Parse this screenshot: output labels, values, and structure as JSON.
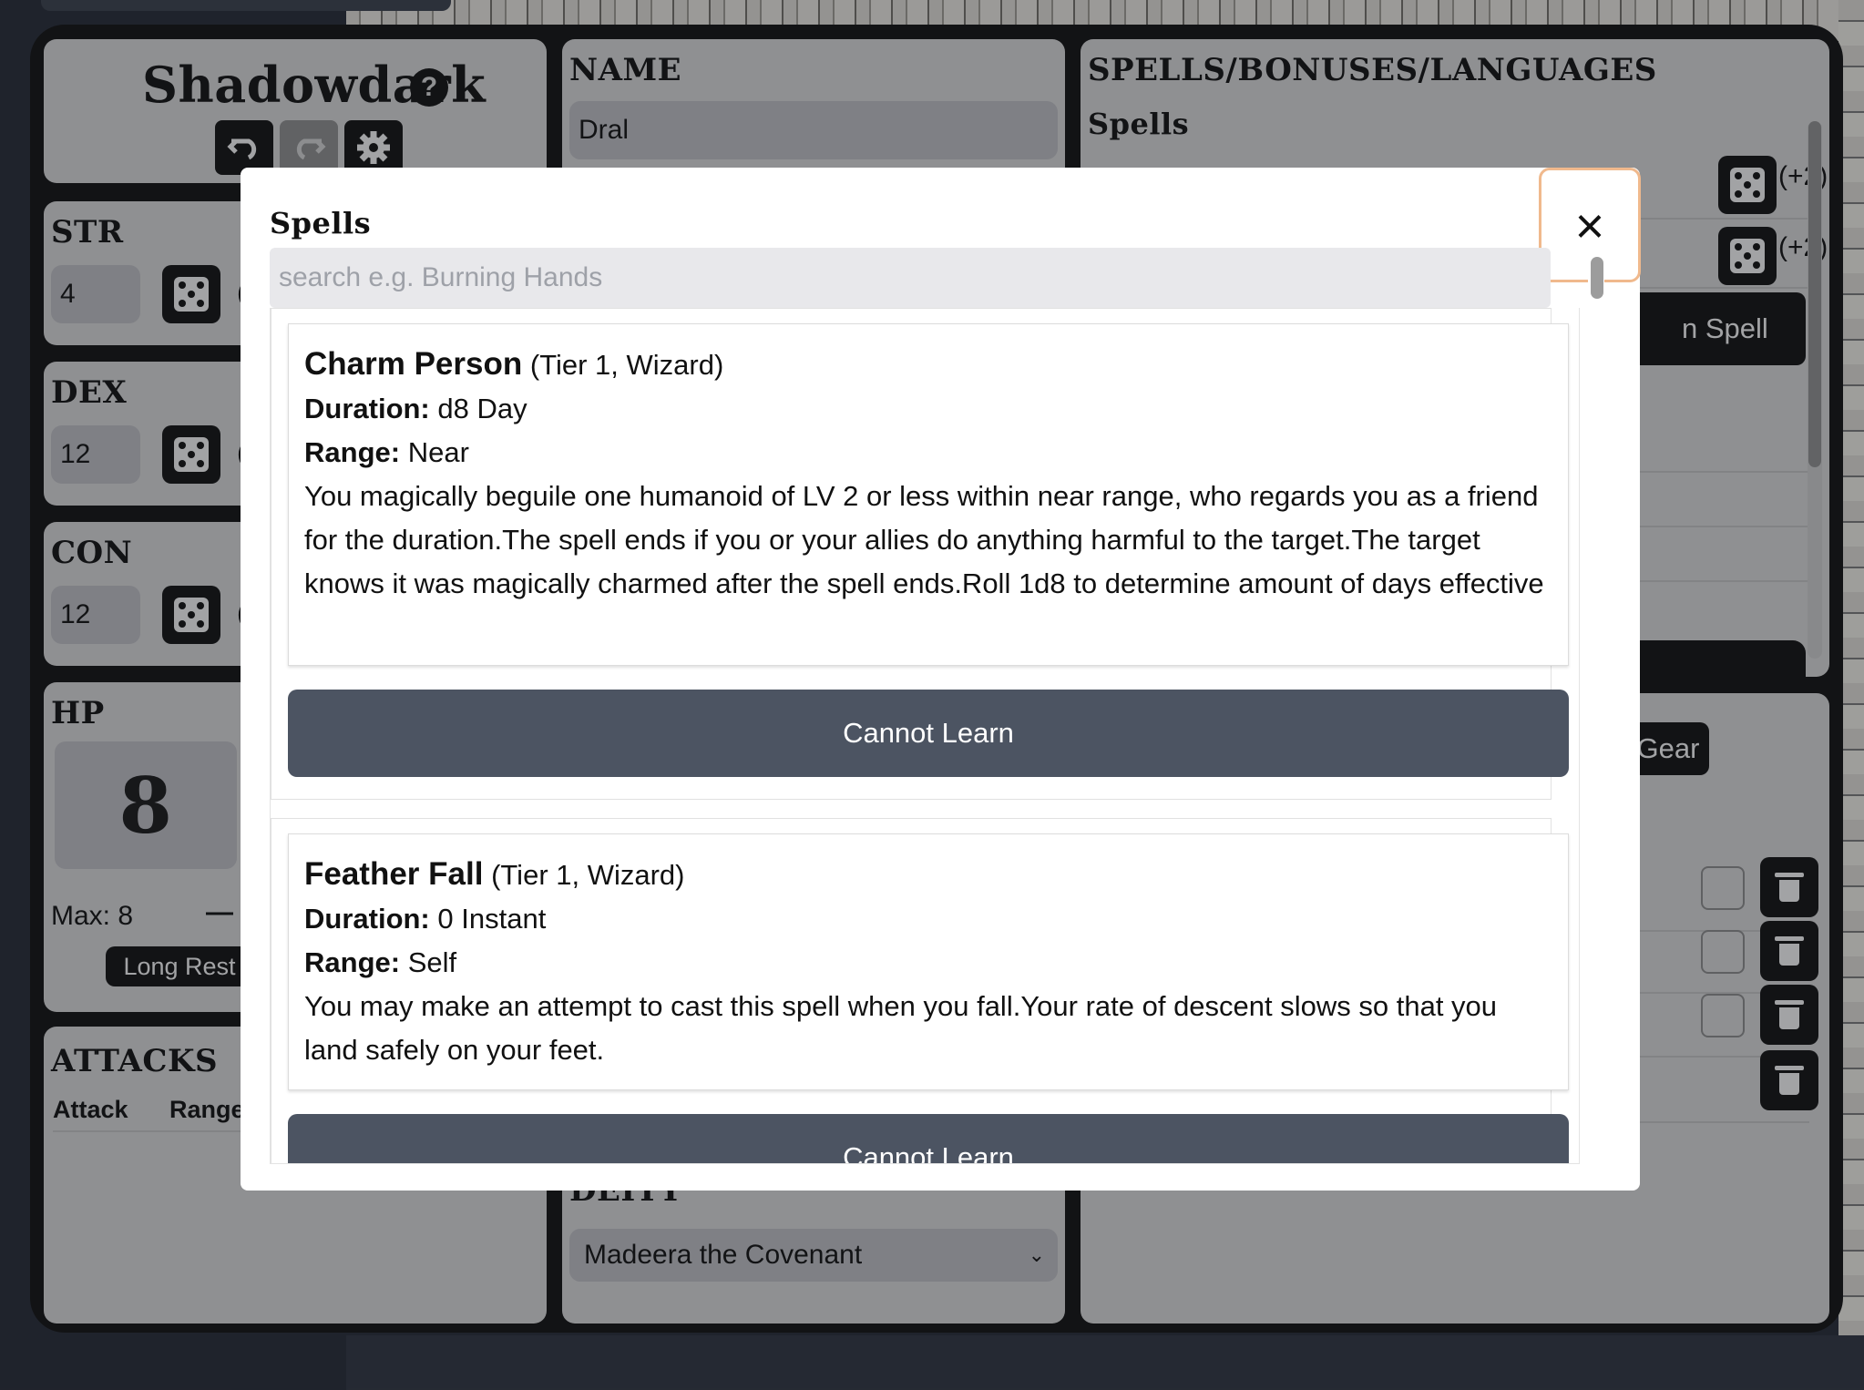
{
  "app": {
    "title": "Shadowdark",
    "help_icon": "?"
  },
  "toolbar": {
    "undo_icon": "undo-icon",
    "redo_icon": "redo-icon",
    "settings_icon": "gear-icon"
  },
  "stats": [
    {
      "label": "STR",
      "value": "4",
      "mod": "(-"
    },
    {
      "label": "DEX",
      "value": "12",
      "mod": "(-"
    },
    {
      "label": "CON",
      "value": "12",
      "mod": "(-"
    }
  ],
  "hp": {
    "label": "HP",
    "value": "8",
    "max_label": "Max: 8",
    "minus": "—",
    "long_rest": "Long Rest"
  },
  "attacks": {
    "label": "ATTACKS",
    "columns": [
      "Attack",
      "Range"
    ]
  },
  "name_section": {
    "label": "NAME",
    "value": "Dral"
  },
  "deity_section": {
    "label": "DEITY",
    "value": "Madeera the Covenant"
  },
  "spells_panel": {
    "label": "SPELLS/BONUSES/LANGUAGES",
    "subtitle": "Spells",
    "mod_1": "(+2)",
    "mod_2": "(+2)",
    "add_spell_partial": "n Spell"
  },
  "gear_panel": {
    "add_gear_partial": "Gear"
  },
  "modal": {
    "title": "Spells",
    "close_label": "×",
    "search_placeholder": "search e.g. Burning Hands",
    "spells": [
      {
        "name": "Charm Person",
        "meta": "(Tier 1, Wizard)",
        "duration_label": "Duration:",
        "duration": "d8 Day",
        "range_label": "Range:",
        "range": "Near",
        "description": "You magically beguile one humanoid of LV 2 or less within near range, who regards you as a friend for the duration.The spell ends if you or your allies do anything harmful to the target.The target knows it was magically charmed after the spell ends.Roll 1d8 to determine amount of days effective",
        "button": "Cannot Learn"
      },
      {
        "name": "Feather Fall",
        "meta": "(Tier 1, Wizard)",
        "duration_label": "Duration:",
        "duration": "0 Instant",
        "range_label": "Range:",
        "range": "Self",
        "description": "You may make an attempt to cast this spell when you fall.Your rate of descent slows so that you land safely on your feet.",
        "button": "Cannot Learn"
      }
    ]
  }
}
